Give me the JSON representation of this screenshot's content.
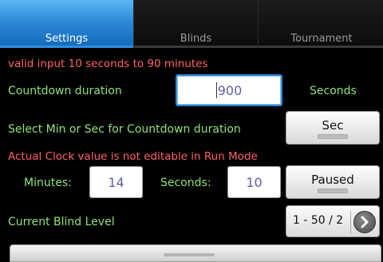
{
  "tabs": [
    {
      "label": "Settings",
      "active": true
    },
    {
      "label": "Blinds",
      "active": false
    },
    {
      "label": "Tournament",
      "active": false
    }
  ],
  "messages": {
    "valid_input": "valid input 10 seconds to 90 minutes",
    "countdown_label": "Countdown duration",
    "seconds_unit": "Seconds",
    "select_min_sec": "Select Min or Sec for Countdown duration",
    "not_editable": "Actual Clock value is not editable in Run Mode",
    "minutes_label": "Minutes:",
    "seconds_label": "Seconds:",
    "current_level_label": "Current Blind Level"
  },
  "inputs": {
    "countdown_value": "900",
    "minutes_value": "14",
    "seconds_value": "10"
  },
  "buttons": {
    "unit_toggle": "Sec",
    "run_toggle": "Paused"
  },
  "blind_level": {
    "value": "1 - 50 / 2"
  },
  "colors": {
    "active_tab": "#2c8ad8",
    "warning_text": "#ff6262",
    "label_text": "#8fe27a"
  }
}
